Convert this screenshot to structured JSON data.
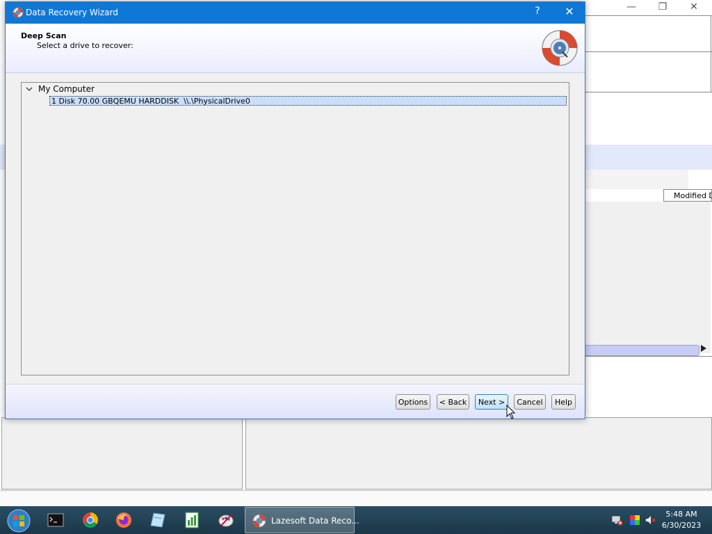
{
  "dialog": {
    "title": "Data Recovery Wizard",
    "help_glyph": "?",
    "close_glyph": "✕",
    "header_title": "Deep Scan",
    "header_subtitle": "Select a drive to recover:",
    "tree": {
      "root_label": "My Computer",
      "expanded": true,
      "drives": [
        {
          "label": "1 Disk 70.00 GBQEMU HARDDISK  \\\\.\\PhysicalDrive0",
          "selected": true
        }
      ]
    },
    "buttons": {
      "options": "Options",
      "back": "< Back",
      "next": "Next >",
      "cancel": "Cancel",
      "help": "Help"
    },
    "focused_button": "next"
  },
  "background_app": {
    "column_header": "Modified D",
    "window_controls": [
      "—",
      "❐",
      "✕"
    ]
  },
  "taskbar": {
    "pinned_icons": [
      "command-prompt-icon",
      "chrome-icon",
      "firefox-icon",
      "notepad-like-icon",
      "spreadsheet-icon",
      "paint-icon"
    ],
    "active_task_label": "Lazesoft Data Reco...",
    "tray_icons": [
      "network-error-icon",
      "color-grid-icon",
      "volume-muted-icon"
    ],
    "clock_time": "5:48 AM",
    "clock_date": "6/30/2023"
  },
  "colors": {
    "titlebar": "#0f78d7",
    "selection": "#c9defb",
    "taskbar": "#1b3748"
  }
}
